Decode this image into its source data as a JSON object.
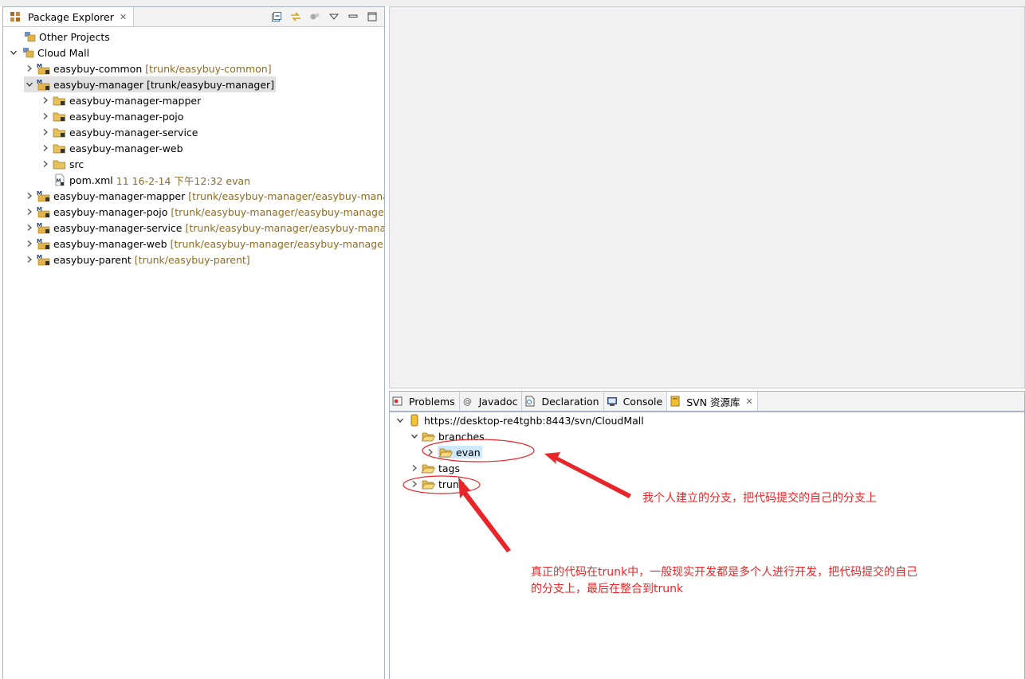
{
  "package_explorer": {
    "title": "Package Explorer",
    "tree": [
      {
        "label": "Other Projects",
        "deco": ""
      },
      {
        "label": "Cloud Mall",
        "deco": ""
      },
      {
        "label": "easybuy-common",
        "deco": "[trunk/easybuy-common]"
      },
      {
        "label": "easybuy-manager",
        "deco": "[trunk/easybuy-manager]"
      },
      {
        "label": "easybuy-manager-mapper",
        "deco": ""
      },
      {
        "label": "easybuy-manager-pojo",
        "deco": ""
      },
      {
        "label": "easybuy-manager-service",
        "deco": ""
      },
      {
        "label": "easybuy-manager-web",
        "deco": ""
      },
      {
        "label": "src",
        "deco": ""
      },
      {
        "label": "pom.xml",
        "deco": "11   16-2-14 下午12:32   evan"
      },
      {
        "label": "easybuy-manager-mapper",
        "deco": "[trunk/easybuy-manager/easybuy-manager-mapper]"
      },
      {
        "label": "easybuy-manager-pojo",
        "deco": "[trunk/easybuy-manager/easybuy-manager-pojo]"
      },
      {
        "label": "easybuy-manager-service",
        "deco": "[trunk/easybuy-manager/easybuy-manager-service]"
      },
      {
        "label": "easybuy-manager-web",
        "deco": "[trunk/easybuy-manager/easybuy-manager-web]"
      },
      {
        "label": "easybuy-parent",
        "deco": "[trunk/easybuy-parent]"
      }
    ]
  },
  "bottom_tabs": {
    "problems": "Problems",
    "javadoc": "Javadoc",
    "declaration": "Declaration",
    "console": "Console",
    "svn": "SVN 资源库"
  },
  "svn_tree": {
    "root": "https://desktop-re4tghb:8443/svn/CloudMall",
    "branches": "branches",
    "evan": "evan",
    "tags": "tags",
    "trunk": "trunk"
  },
  "annotations": {
    "branch_note": "我个人建立的分支，把代码提交的自己的分支上",
    "trunk_note_line1": "真正的代码在trunk中，一般现实开发都是多个人进行开发，把代码提交的自己",
    "trunk_note_line2": "的分支上，最后在整合到trunk"
  },
  "colors": {
    "annotation": "#e8262a",
    "svn_decoration": "#8d6c26",
    "selection": "#cde8ff"
  }
}
